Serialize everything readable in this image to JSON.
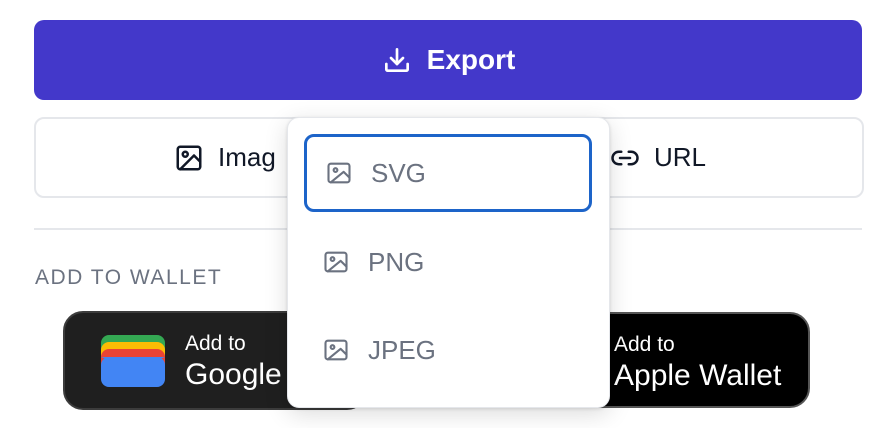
{
  "export": {
    "label": "Export"
  },
  "format_row": {
    "image_label": "Imag",
    "url_label": "URL"
  },
  "wallet": {
    "section_label": "ADD TO WALLET",
    "google": {
      "line1": "Add to",
      "line2": "Google"
    },
    "apple": {
      "line1": "Add to",
      "line2": "Apple Wallet"
    }
  },
  "dropdown": {
    "options": [
      {
        "label": "SVG",
        "focused": true
      },
      {
        "label": "PNG",
        "focused": false
      },
      {
        "label": "JPEG",
        "focused": false
      }
    ]
  },
  "colors": {
    "accent": "#4338ca",
    "focus_ring": "#1d64c9",
    "muted_text": "#6b7280"
  },
  "icons": [
    "download-icon",
    "image-icon",
    "link-icon",
    "google-wallet-logo"
  ]
}
